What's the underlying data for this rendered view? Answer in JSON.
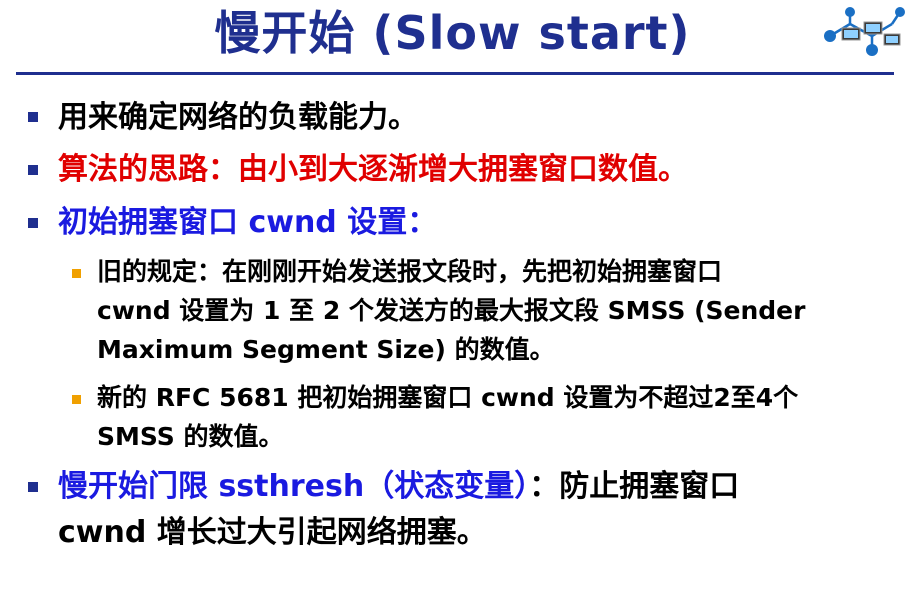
{
  "title": "慢开始 (Slow start)",
  "colors": {
    "heading": "#1f2f8f",
    "bullet": "#1f2f8f",
    "sub_bullet": "#f0a000",
    "highlight_red": "#e00000",
    "highlight_blue": "#1a1ae0"
  },
  "logo": {
    "icon": "network-computers-icon"
  },
  "bullets": [
    {
      "text": "用来确定网络的负载能力。"
    },
    {
      "text": "算法的思路：由小到大逐渐增大拥塞窗口数值。"
    },
    {
      "text": "初始拥塞窗口 cwnd 设置：",
      "sub": [
        {
          "lines": [
            "旧的规定：在刚刚开始发送报文段时，先把初始拥塞窗口",
            "cwnd 设置为 1 至 2 个发送方的最大报文段 SMSS (Sender",
            "Maximum Segment Size) 的数值。"
          ]
        },
        {
          "lines": [
            "新的 RFC 5681 把初始拥塞窗口 cwnd 设置为不超过2至4个",
            "SMSS 的数值。"
          ]
        }
      ]
    },
    {
      "part1": "慢开始门限 ssthresh（状态变量）",
      "part2": "：防止拥塞窗口",
      "line2": "cwnd 增长过大引起网络拥塞。"
    }
  ]
}
